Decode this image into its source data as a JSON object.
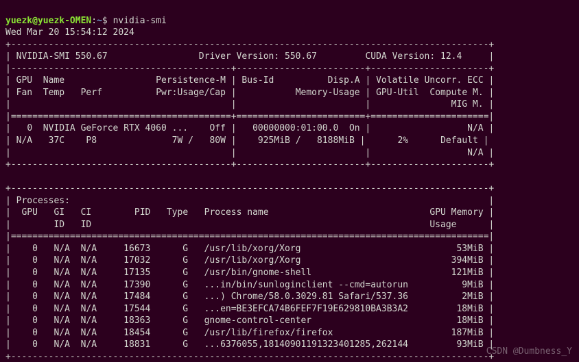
{
  "prompt": {
    "user": "yuezk",
    "at": "@",
    "host": "yuezk-OMEN",
    "colon": ":",
    "path": "~",
    "dollar": "$ "
  },
  "command": "nvidia-smi",
  "datetime": "Wed Mar 20 15:54:12 2024",
  "header": {
    "smi_version_label": "NVIDIA-SMI",
    "smi_version": "550.67",
    "driver_version_label": "Driver Version:",
    "driver_version": "550.67",
    "cuda_version_label": "CUDA Version:",
    "cuda_version": "12.4"
  },
  "gpu_header_cols": {
    "gpu": "GPU",
    "name": "Name",
    "persistence": "Persistence-M",
    "fan": "Fan",
    "temp": "Temp",
    "perf": "Perf",
    "pwr": "Pwr:Usage/Cap",
    "busid": "Bus-Id",
    "dispa": "Disp.A",
    "memusage": "Memory-Usage",
    "vol": "Volatile",
    "uncorr": "Uncorr. ECC",
    "gpuutil": "GPU-Util",
    "compute": "Compute M.",
    "mig": "MIG M."
  },
  "gpu_rows": [
    {
      "idx": "0",
      "name": "NVIDIA GeForce RTX 4060 ...",
      "persistence": "Off",
      "busid": "00000000:01:00.0",
      "dispa": "On",
      "ecc": "N/A",
      "fan": "N/A",
      "temp": "37C",
      "perf": "P8",
      "pwr": "7W /   80W",
      "mem_used": "925MiB",
      "mem_total": "8188MiB",
      "util": "2%",
      "compute": "Default",
      "mig": "N/A"
    }
  ],
  "processes_header": {
    "title": "Processes:",
    "gpu": "GPU",
    "gi": "GI",
    "ci": "CI",
    "pid": "PID",
    "type": "Type",
    "proc_name": "Process name",
    "gpu_mem_l1": "GPU Memory",
    "gpu_mem_l2": "Usage",
    "id": "ID"
  },
  "processes": [
    {
      "gpu": "0",
      "gi": "N/A",
      "ci": "N/A",
      "pid": "16673",
      "type": "G",
      "name": "/usr/lib/xorg/Xorg",
      "mem": "53MiB"
    },
    {
      "gpu": "0",
      "gi": "N/A",
      "ci": "N/A",
      "pid": "17032",
      "type": "G",
      "name": "/usr/lib/xorg/Xorg",
      "mem": "394MiB"
    },
    {
      "gpu": "0",
      "gi": "N/A",
      "ci": "N/A",
      "pid": "17135",
      "type": "G",
      "name": "/usr/bin/gnome-shell",
      "mem": "121MiB"
    },
    {
      "gpu": "0",
      "gi": "N/A",
      "ci": "N/A",
      "pid": "17390",
      "type": "G",
      "name": "...in/bin/sunloginclient --cmd=autorun",
      "mem": "9MiB"
    },
    {
      "gpu": "0",
      "gi": "N/A",
      "ci": "N/A",
      "pid": "17484",
      "type": "G",
      "name": "...) Chrome/58.0.3029.81 Safari/537.36",
      "mem": "2MiB"
    },
    {
      "gpu": "0",
      "gi": "N/A",
      "ci": "N/A",
      "pid": "17544",
      "type": "G",
      "name": "...en=BE3EFCA74B6FEF7F19E629810BA3B3A2",
      "mem": "18MiB"
    },
    {
      "gpu": "0",
      "gi": "N/A",
      "ci": "N/A",
      "pid": "18363",
      "type": "G",
      "name": "gnome-control-center",
      "mem": "18MiB"
    },
    {
      "gpu": "0",
      "gi": "N/A",
      "ci": "N/A",
      "pid": "18454",
      "type": "G",
      "name": "/usr/lib/firefox/firefox",
      "mem": "187MiB"
    },
    {
      "gpu": "0",
      "gi": "N/A",
      "ci": "N/A",
      "pid": "18831",
      "type": "G",
      "name": "...6376055,18140901191323401285,262144",
      "mem": "93MiB"
    }
  ],
  "watermark": "CSDN @Dumbness_Y",
  "borders": {
    "top": "+-----------------------------------------------------------------------------------------+",
    "sep": "|-----------------------------------------+------------------------+----------------------+",
    "eq": "|=========================================+========================+======================|",
    "eq2": "|=========================================================================================|",
    "bottom": "+-----------------------------------------+------------------------+----------------------+",
    "ptop": "+-----------------------------------------------------------------------------------------+",
    "pbot": "+-----------------------------------------------------------------------------------------+"
  }
}
